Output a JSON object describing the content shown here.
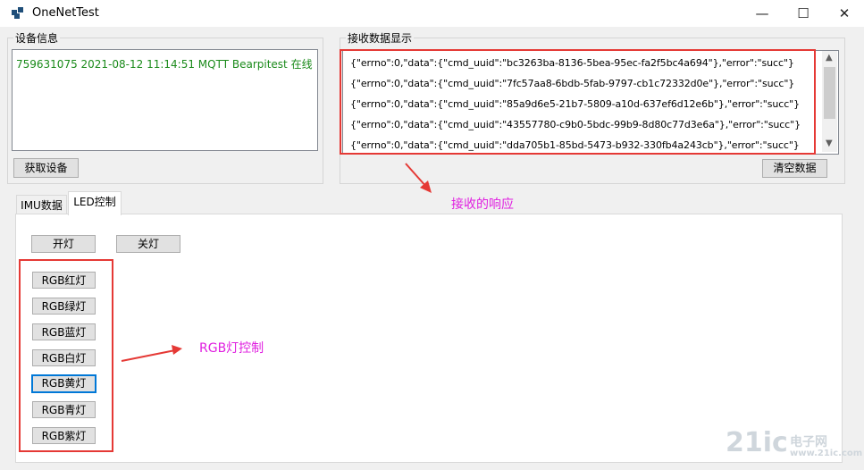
{
  "window": {
    "title": "OneNetTest",
    "minimize_glyph": "—",
    "maximize_glyph": "☐",
    "close_glyph": "✕"
  },
  "device_group": {
    "label": "设备信息",
    "device": "759631075   2021-08-12 11:14:51   MQTT   Bearpitest   在线",
    "get_button": "获取设备"
  },
  "recv_group": {
    "label": "接收数据显示",
    "lines": [
      "{\"errno\":0,\"data\":{\"cmd_uuid\":\"bc3263ba-8136-5bea-95ec-fa2f5bc4a694\"},\"error\":\"succ\"}",
      "{\"errno\":0,\"data\":{\"cmd_uuid\":\"7fc57aa8-6bdb-5fab-9797-cb1c72332d0e\"},\"error\":\"succ\"}",
      "{\"errno\":0,\"data\":{\"cmd_uuid\":\"85a9d6e5-21b7-5809-a10d-637ef6d12e6b\"},\"error\":\"succ\"}",
      "{\"errno\":0,\"data\":{\"cmd_uuid\":\"43557780-c9b0-5bdc-99b9-8d80c77d3e6a\"},\"error\":\"succ\"}",
      "{\"errno\":0,\"data\":{\"cmd_uuid\":\"dda705b1-85bd-5473-b932-330fb4a243cb\"},\"error\":\"succ\"}"
    ],
    "clear_button": "清空数据"
  },
  "tabs": [
    "IMU数据",
    "LED控制"
  ],
  "led_panel": {
    "on_button": "开灯",
    "off_button": "关灯",
    "rgb_buttons": [
      "RGB红灯",
      "RGB绿灯",
      "RGB蓝灯",
      "RGB白灯",
      "RGB黄灯",
      "RGB青灯",
      "RGB紫灯"
    ]
  },
  "annotations": {
    "response": "接收的响应",
    "rgb_control": "RGB灯控制",
    "color": "#e020e0",
    "box_color": "#e53935"
  },
  "watermark": {
    "text": "21ic",
    "cn": "电子网",
    "site": "www.21ic.com"
  },
  "colors": {
    "device_text": "#1a8a1a",
    "focus_border": "#0078d7"
  }
}
